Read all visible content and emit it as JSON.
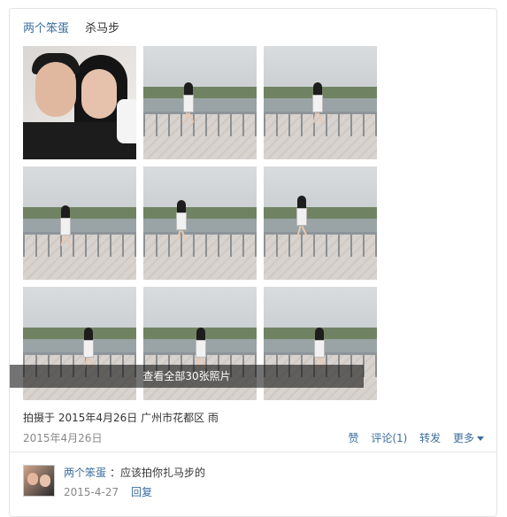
{
  "post": {
    "author": "两个笨蛋",
    "title": "杀马步",
    "photos": [
      {
        "alt": "selfie"
      },
      {
        "alt": "pose"
      },
      {
        "alt": "pose"
      },
      {
        "alt": "pose"
      },
      {
        "alt": "pose"
      },
      {
        "alt": "pose"
      },
      {
        "alt": "pose"
      },
      {
        "alt": "pose"
      },
      {
        "alt": "pose"
      }
    ],
    "view_all": "查看全部30张照片",
    "meta": "拍摄于 2015年4月26日 广州市花都区 雨",
    "date": "2015年4月26日",
    "actions": {
      "like": "赞",
      "comment": "评论(1)",
      "share": "转发",
      "more": "更多"
    }
  },
  "comment": {
    "author": "两个笨蛋",
    "text": "：应该拍你扎马步的",
    "date": "2015-4-27",
    "reply": "回复"
  }
}
